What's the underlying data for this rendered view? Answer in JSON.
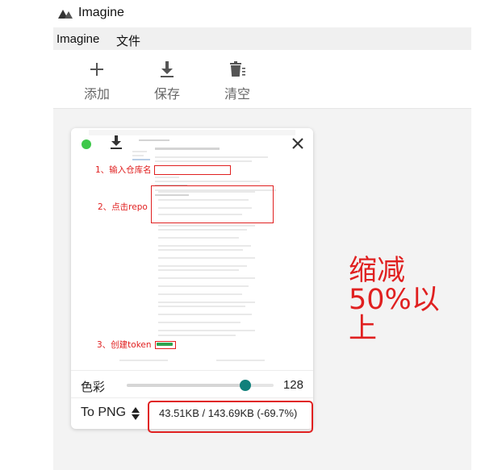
{
  "app": {
    "title": "Imagine"
  },
  "menu": {
    "items": [
      "Imagine",
      "文件"
    ]
  },
  "toolbar": {
    "add_label": "添加",
    "save_label": "保存",
    "clear_label": "清空"
  },
  "preview": {
    "annotations": [
      "1、输入仓库名",
      "2、点击repo",
      "3、创建token"
    ]
  },
  "controls": {
    "color_label": "色彩",
    "color_value": "128",
    "color_fraction": 0.81,
    "format_label": "To PNG",
    "size_text": "43.51KB / 143.69KB (-69.7%)"
  },
  "note": {
    "text": "缩减50%以上"
  },
  "colors": {
    "accent": "#10807b",
    "annotation": "#e02020",
    "status": "#3ec84a"
  }
}
